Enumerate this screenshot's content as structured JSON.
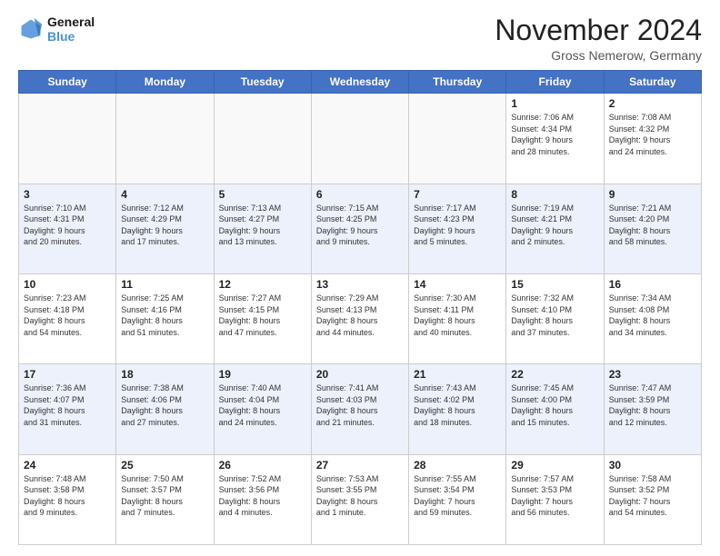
{
  "header": {
    "logo_line1": "General",
    "logo_line2": "Blue",
    "month_title": "November 2024",
    "location": "Gross Nemerow, Germany"
  },
  "weekdays": [
    "Sunday",
    "Monday",
    "Tuesday",
    "Wednesday",
    "Thursday",
    "Friday",
    "Saturday"
  ],
  "weeks": [
    [
      {
        "day": "",
        "info": ""
      },
      {
        "day": "",
        "info": ""
      },
      {
        "day": "",
        "info": ""
      },
      {
        "day": "",
        "info": ""
      },
      {
        "day": "",
        "info": ""
      },
      {
        "day": "1",
        "info": "Sunrise: 7:06 AM\nSunset: 4:34 PM\nDaylight: 9 hours\nand 28 minutes."
      },
      {
        "day": "2",
        "info": "Sunrise: 7:08 AM\nSunset: 4:32 PM\nDaylight: 9 hours\nand 24 minutes."
      }
    ],
    [
      {
        "day": "3",
        "info": "Sunrise: 7:10 AM\nSunset: 4:31 PM\nDaylight: 9 hours\nand 20 minutes."
      },
      {
        "day": "4",
        "info": "Sunrise: 7:12 AM\nSunset: 4:29 PM\nDaylight: 9 hours\nand 17 minutes."
      },
      {
        "day": "5",
        "info": "Sunrise: 7:13 AM\nSunset: 4:27 PM\nDaylight: 9 hours\nand 13 minutes."
      },
      {
        "day": "6",
        "info": "Sunrise: 7:15 AM\nSunset: 4:25 PM\nDaylight: 9 hours\nand 9 minutes."
      },
      {
        "day": "7",
        "info": "Sunrise: 7:17 AM\nSunset: 4:23 PM\nDaylight: 9 hours\nand 5 minutes."
      },
      {
        "day": "8",
        "info": "Sunrise: 7:19 AM\nSunset: 4:21 PM\nDaylight: 9 hours\nand 2 minutes."
      },
      {
        "day": "9",
        "info": "Sunrise: 7:21 AM\nSunset: 4:20 PM\nDaylight: 8 hours\nand 58 minutes."
      }
    ],
    [
      {
        "day": "10",
        "info": "Sunrise: 7:23 AM\nSunset: 4:18 PM\nDaylight: 8 hours\nand 54 minutes."
      },
      {
        "day": "11",
        "info": "Sunrise: 7:25 AM\nSunset: 4:16 PM\nDaylight: 8 hours\nand 51 minutes."
      },
      {
        "day": "12",
        "info": "Sunrise: 7:27 AM\nSunset: 4:15 PM\nDaylight: 8 hours\nand 47 minutes."
      },
      {
        "day": "13",
        "info": "Sunrise: 7:29 AM\nSunset: 4:13 PM\nDaylight: 8 hours\nand 44 minutes."
      },
      {
        "day": "14",
        "info": "Sunrise: 7:30 AM\nSunset: 4:11 PM\nDaylight: 8 hours\nand 40 minutes."
      },
      {
        "day": "15",
        "info": "Sunrise: 7:32 AM\nSunset: 4:10 PM\nDaylight: 8 hours\nand 37 minutes."
      },
      {
        "day": "16",
        "info": "Sunrise: 7:34 AM\nSunset: 4:08 PM\nDaylight: 8 hours\nand 34 minutes."
      }
    ],
    [
      {
        "day": "17",
        "info": "Sunrise: 7:36 AM\nSunset: 4:07 PM\nDaylight: 8 hours\nand 31 minutes."
      },
      {
        "day": "18",
        "info": "Sunrise: 7:38 AM\nSunset: 4:06 PM\nDaylight: 8 hours\nand 27 minutes."
      },
      {
        "day": "19",
        "info": "Sunrise: 7:40 AM\nSunset: 4:04 PM\nDaylight: 8 hours\nand 24 minutes."
      },
      {
        "day": "20",
        "info": "Sunrise: 7:41 AM\nSunset: 4:03 PM\nDaylight: 8 hours\nand 21 minutes."
      },
      {
        "day": "21",
        "info": "Sunrise: 7:43 AM\nSunset: 4:02 PM\nDaylight: 8 hours\nand 18 minutes."
      },
      {
        "day": "22",
        "info": "Sunrise: 7:45 AM\nSunset: 4:00 PM\nDaylight: 8 hours\nand 15 minutes."
      },
      {
        "day": "23",
        "info": "Sunrise: 7:47 AM\nSunset: 3:59 PM\nDaylight: 8 hours\nand 12 minutes."
      }
    ],
    [
      {
        "day": "24",
        "info": "Sunrise: 7:48 AM\nSunset: 3:58 PM\nDaylight: 8 hours\nand 9 minutes."
      },
      {
        "day": "25",
        "info": "Sunrise: 7:50 AM\nSunset: 3:57 PM\nDaylight: 8 hours\nand 7 minutes."
      },
      {
        "day": "26",
        "info": "Sunrise: 7:52 AM\nSunset: 3:56 PM\nDaylight: 8 hours\nand 4 minutes."
      },
      {
        "day": "27",
        "info": "Sunrise: 7:53 AM\nSunset: 3:55 PM\nDaylight: 8 hours\nand 1 minute."
      },
      {
        "day": "28",
        "info": "Sunrise: 7:55 AM\nSunset: 3:54 PM\nDaylight: 7 hours\nand 59 minutes."
      },
      {
        "day": "29",
        "info": "Sunrise: 7:57 AM\nSunset: 3:53 PM\nDaylight: 7 hours\nand 56 minutes."
      },
      {
        "day": "30",
        "info": "Sunrise: 7:58 AM\nSunset: 3:52 PM\nDaylight: 7 hours\nand 54 minutes."
      }
    ]
  ]
}
